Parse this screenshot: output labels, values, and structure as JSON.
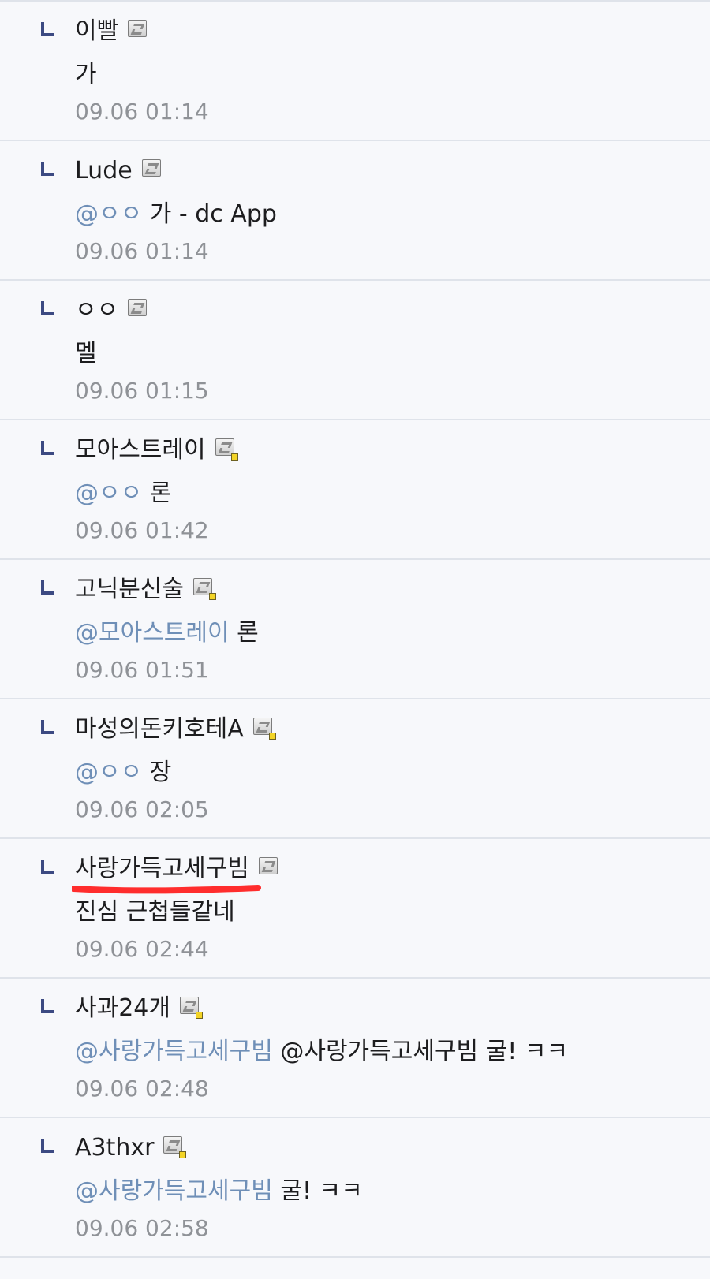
{
  "comments": [
    {
      "nickname": "이빨",
      "icon": "gallog-icon",
      "mention": "",
      "text": "가",
      "date": "09.06 01:14"
    },
    {
      "nickname": "Lude",
      "icon": "gallog-icon",
      "mention": "@ㅇㅇ",
      "text": " 가 - dc App",
      "date": "09.06 01:14"
    },
    {
      "nickname": "ㅇㅇ",
      "icon": "gallog-icon",
      "mention": "",
      "text": "멜",
      "date": "09.06 01:15"
    },
    {
      "nickname": "모아스트레이",
      "icon": "gallog-icon-fixed",
      "mention": "@ㅇㅇ",
      "text": " 론",
      "date": "09.06 01:42"
    },
    {
      "nickname": "고닉분신술",
      "icon": "gallog-icon-fixed",
      "mention": "@모아스트레이",
      "text": " 론",
      "date": "09.06 01:51"
    },
    {
      "nickname": "마성의돈키호테A",
      "icon": "gallog-icon-fixed",
      "mention": "@ㅇㅇ",
      "text": " 장",
      "date": "09.06 02:05"
    },
    {
      "nickname": "사랑가득고세구빔",
      "icon": "gallog-icon",
      "mention": "",
      "text": "진심 근첩들같네",
      "date": "09.06 02:44",
      "highlight": "red-underline"
    },
    {
      "nickname": "사과24개",
      "icon": "gallog-icon-fixed",
      "mention": "@사랑가득고세구빔",
      "text": " @사랑가득고세구빔 굴! ㅋㅋ",
      "date": "09.06 02:48"
    },
    {
      "nickname": "A3thxr",
      "icon": "gallog-icon-fixed",
      "mention": "@사랑가득고세구빔",
      "text": " 굴! ㅋㅋ",
      "date": "09.06 02:58"
    }
  ],
  "colors": {
    "background": "#f7f8fb",
    "text": "#1d1d1f",
    "mention": "#6f8fb7",
    "date": "#8f9297",
    "reply_mark": "#3c4a82",
    "underline": "#ff2d2d"
  }
}
